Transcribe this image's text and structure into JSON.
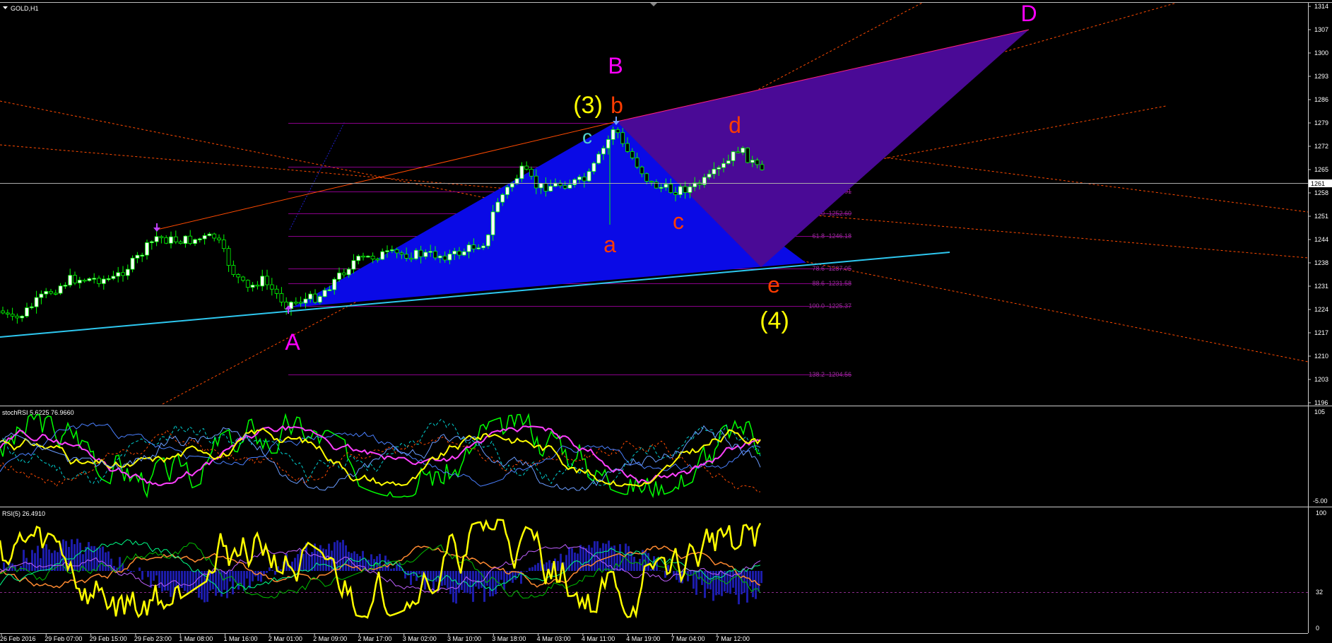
{
  "window": {
    "title": "GOLD,H1",
    "menu_icon": "triangle-down-icon"
  },
  "colors": {
    "background": "#000000",
    "axis": "#ffffff",
    "bull_candle": "#ffffff",
    "bear_candle": "#000000",
    "candle_outline": "#00ff00",
    "cyan_trendline": "#2ec8f0",
    "orange_line": "#ff4a00",
    "blue_triangle": "#0a0ae6",
    "purple_triangle": "#4a0a96",
    "fib_level": "#8a008a",
    "magenta_label": "#ff00ff",
    "orange_label": "#ff3c00",
    "yellow_label": "#ffff00",
    "cyan_label": "#4fd0d0",
    "rsi_line": "#ffff00",
    "histogram": "#1c1caa"
  },
  "price_axis": {
    "ticks": [
      "1314",
      "1307",
      "1300",
      "1293",
      "1286",
      "1279",
      "1272",
      "1265",
      "1258",
      "1251",
      "1244",
      "1238",
      "1231",
      "1224",
      "1217",
      "1210",
      "1203",
      "1196"
    ],
    "current_price": "1261"
  },
  "time_axis": {
    "labels": [
      "26 Feb 2016",
      "29 Feb 07:00",
      "29 Feb 15:00",
      "29 Feb 23:00",
      "1 Mar 08:00",
      "1 Mar 16:00",
      "2 Mar 01:00",
      "2 Mar 09:00",
      "2 Mar 17:00",
      "3 Mar 02:00",
      "3 Mar 10:00",
      "3 Mar 18:00",
      "4 Mar 03:00",
      "4 Mar 11:00",
      "4 Mar 19:00",
      "7 Mar 04:00",
      "7 Mar 12:00"
    ]
  },
  "fibonacci": [
    "0.0 -1279.63",
    "23.6 -1266.98",
    "38.2 -1259.01",
    "50.0 -1252.60",
    "61.8 -1246.18",
    "78.6 -1237.05",
    "88.6 -1231.58",
    "100.0 -1225.37",
    "138.2 -1204.56"
  ],
  "wave_labels": {
    "A": "A",
    "B": "B",
    "D": "D",
    "wave3": "(3)",
    "wave4": "(4)",
    "b": "b",
    "c_top": "c",
    "d": "d",
    "a": "a",
    "c": "c",
    "e": "e"
  },
  "stoch_panel": {
    "title": "stochRSI 5.6225 76.9660",
    "ticks": [
      "105",
      "-5.00"
    ]
  },
  "rsi_panel": {
    "title": "RSI(5) 26.4910",
    "ticks": [
      "100",
      "32",
      "0"
    ]
  }
}
